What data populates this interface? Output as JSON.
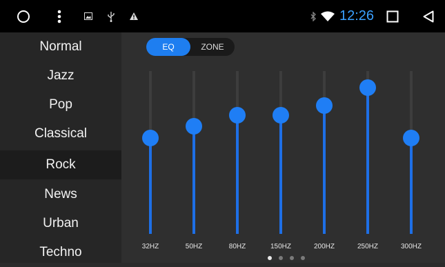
{
  "status_bar": {
    "icons": [
      "home-circle-icon",
      "more-vertical-icon",
      "image-icon",
      "usb-icon",
      "warning-icon",
      "bluetooth-icon",
      "wifi-icon",
      "recents-square-icon",
      "back-triangle-icon"
    ],
    "time": "12:26",
    "colors": {
      "background": "#000000",
      "time": "#3aa0ff"
    }
  },
  "presets": {
    "items": [
      "Normal",
      "Jazz",
      "Pop",
      "Classical",
      "Rock",
      "News",
      "Urban",
      "Techno"
    ],
    "selected": "Rock"
  },
  "mode_toggle": {
    "options": [
      "EQ",
      "ZONE"
    ],
    "selected": "EQ"
  },
  "equalizer": {
    "bands": [
      {
        "label": "32HZ",
        "level": 0.59
      },
      {
        "label": "50HZ",
        "level": 0.66
      },
      {
        "label": "80HZ",
        "level": 0.73
      },
      {
        "label": "150HZ",
        "level": 0.73
      },
      {
        "label": "200HZ",
        "level": 0.79
      },
      {
        "label": "250HZ",
        "level": 0.9
      },
      {
        "label": "300HZ",
        "level": 0.59
      }
    ],
    "accent_color": "#1f7ef5"
  },
  "pager": {
    "count": 4,
    "current": 1
  }
}
